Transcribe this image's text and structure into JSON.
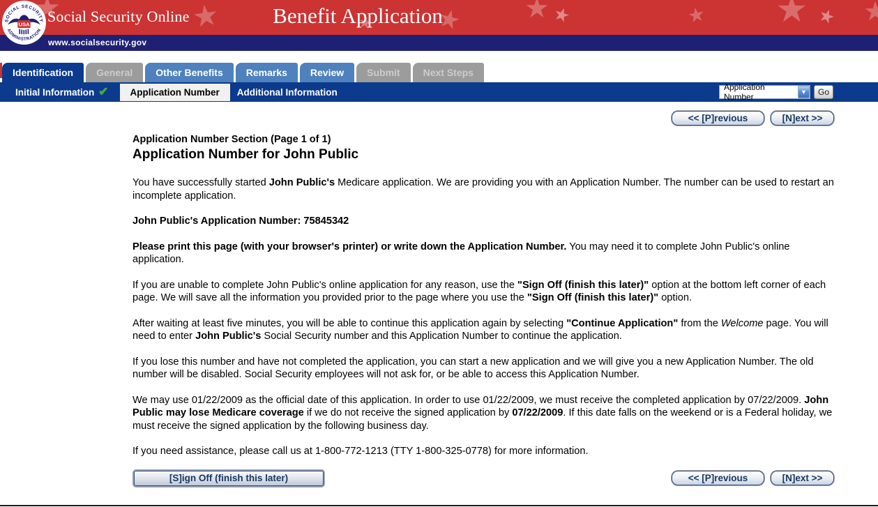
{
  "colors": {
    "header-red": "#CC3333",
    "star-red": "#DA6C6C",
    "navy": "#1E2173",
    "bar-blue": "#0C3A8C",
    "tab-blue": "#4E81BD",
    "tab-gray": "#9C9C9C",
    "tab-gray-text": "#CCCCCC",
    "check-green": "#2FBF00",
    "button-text": "#17375E"
  },
  "header": {
    "brand": "Social Security Online",
    "app_title": "Benefit Application",
    "site_url": "www.socialsecurity.gov",
    "logo": {
      "top_text": "SOCIAL SECURITY",
      "bottom_text": "ADMINISTRATION",
      "center_text": "USA"
    }
  },
  "tabs": [
    {
      "label": "Identification",
      "state": "active"
    },
    {
      "label": "General",
      "state": "disabled"
    },
    {
      "label": "Other Benefits",
      "state": "enabled"
    },
    {
      "label": "Remarks",
      "state": "enabled"
    },
    {
      "label": "Review",
      "state": "enabled"
    },
    {
      "label": "Submit",
      "state": "disabled"
    },
    {
      "label": "Next Steps",
      "state": "disabled"
    }
  ],
  "subnav": {
    "items": [
      {
        "label": "Initial Information",
        "checked": true
      },
      {
        "label": "Application Number",
        "current": true
      },
      {
        "label": "Additional Information"
      }
    ],
    "jump": {
      "selected": "Application Number",
      "chevron": "▼",
      "go_label": "Go"
    }
  },
  "nav_buttons": {
    "previous": "<< [P]revious",
    "next": "[N]ext >>"
  },
  "content": {
    "section_title": "Application Number Section (Page 1 of 1)",
    "page_title": "Application Number for John Public",
    "p1": [
      {
        "t": "You have successfully started "
      },
      {
        "t": "John Public's",
        "b": true
      },
      {
        "t": " Medicare application. We are providing you with an Application Number. The number can be used to restart an incomplete application."
      }
    ],
    "app_number_line": "John Public's Application Number: 75845342",
    "p2": [
      {
        "t": "Please print this page (with your browser's printer) or write down the Application Number.",
        "b": true
      },
      {
        "t": " You may need it to complete John Public's online application."
      }
    ],
    "p3": [
      {
        "t": "If you are unable to complete John Public's online application for any reason, use the "
      },
      {
        "t": "\"Sign Off (finish this later)\"",
        "b": true
      },
      {
        "t": " option at the bottom left corner of each page. We will save all the information you provided prior to the page where you use the "
      },
      {
        "t": "\"Sign Off (finish this later)\"",
        "b": true
      },
      {
        "t": " option."
      }
    ],
    "p4": [
      {
        "t": "After waiting at least five minutes, you will be able to continue this application again by selecting "
      },
      {
        "t": "\"Continue Application\"",
        "b": true
      },
      {
        "t": " from the "
      },
      {
        "t": "Welcome",
        "i": true
      },
      {
        "t": " page. You will need to enter "
      },
      {
        "t": "John Public's",
        "b": true
      },
      {
        "t": " Social Security number and this Application Number to continue the application."
      }
    ],
    "p5": [
      {
        "t": "If you lose this number and have not completed the application, you can start a new application and we will give you a new Application Number. The old number will be disabled. Social Security employees will not ask for, or be able to access this Application Number."
      }
    ],
    "p6": [
      {
        "t": "We may use 01/22/2009 as the official date of this application. In order to use 01/22/2009, we must receive the completed application by 07/22/2009. "
      },
      {
        "t": "John Public may lose Medicare coverage",
        "b": true
      },
      {
        "t": " if we do not receive the signed application by "
      },
      {
        "t": "07/22/2009",
        "b": true
      },
      {
        "t": ". If this date falls on the weekend or is a Federal holiday, we must receive the signed application by the following business day."
      }
    ],
    "p7": [
      {
        "t": "If you need assistance, please call us at 1-800-772-1213 (TTY 1-800-325-0778) for more information."
      }
    ],
    "sign_off_label": "[S]ign Off (finish this later)"
  }
}
